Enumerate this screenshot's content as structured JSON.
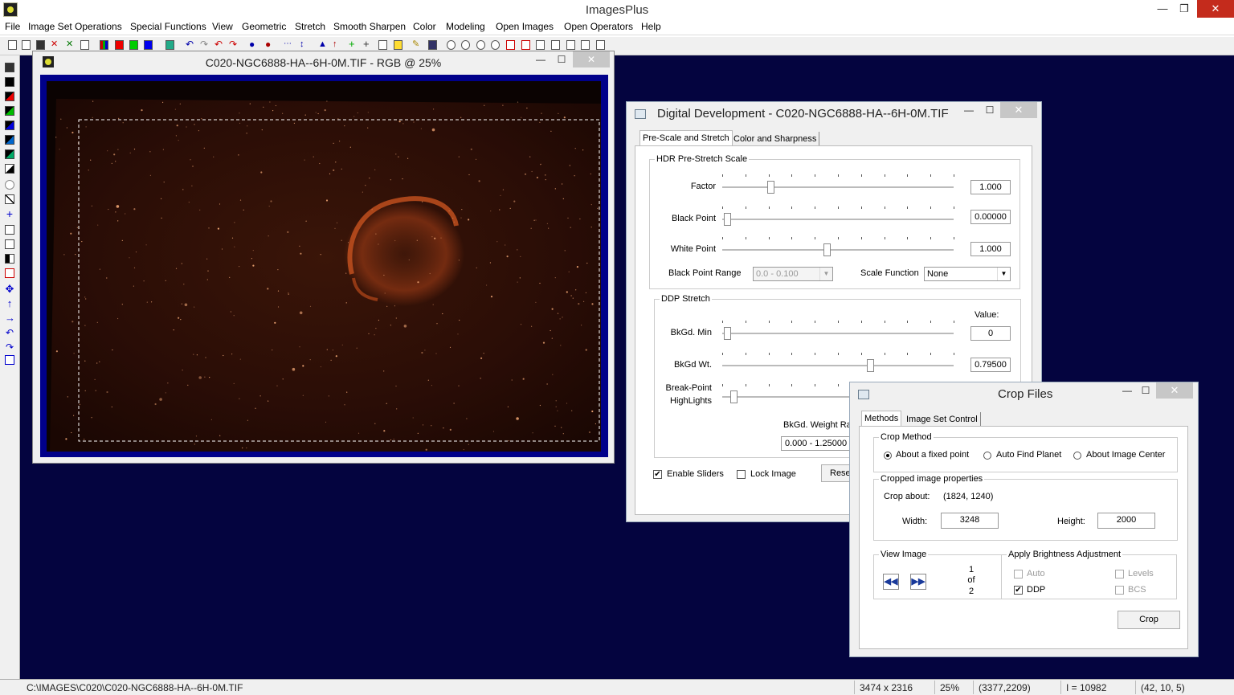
{
  "app": {
    "title": "ImagesPlus"
  },
  "menu": [
    "File",
    "Image Set Operations",
    "Special Functions",
    "View",
    "Geometric",
    "Stretch",
    "Smooth Sharpen",
    "Color",
    "Modeling",
    "Open Images",
    "Open Operators",
    "Help"
  ],
  "image_window": {
    "title": "C020-NGC6888-HA--6H-0M.TIF - RGB @ 25%"
  },
  "dev_dialog": {
    "title": "Digital Development - C020-NGC6888-HA--6H-0M.TIF",
    "tabs": [
      "Pre-Scale and Stretch",
      "Color and Sharpness"
    ],
    "hdr_group": "HDR Pre-Stretch Scale",
    "factor": {
      "label": "Factor",
      "value": "1.000",
      "slider_fraction": 0.21
    },
    "black_point": {
      "label": "Black Point",
      "value": "0.00000",
      "slider_fraction": 0.02
    },
    "white_point": {
      "label": "White Point",
      "value": "1.000",
      "slider_fraction": 0.45
    },
    "black_point_range": {
      "label": "Black Point Range",
      "value": "0.0 - 0.100"
    },
    "scale_function": {
      "label": "Scale Function",
      "value": "None"
    },
    "ddp_group": "DDP Stretch",
    "value_header": "Value:",
    "bkgd_min": {
      "label": "BkGd. Min",
      "value": "0",
      "slider_fraction": 0.02
    },
    "bkgd_wt": {
      "label": "BkGd Wt.",
      "value": "0.79500",
      "slider_fraction": 0.64
    },
    "break_point": {
      "label_line1": "Break-Point",
      "label_line2": "HighLights",
      "slider_fraction": 0.05
    },
    "bkgd_weight_range": {
      "label": "BkGd. Weight Ra",
      "value": "0.000 - 1.25000"
    },
    "enable_sliders": {
      "label": "Enable Sliders",
      "checked": true
    },
    "lock_image": {
      "label": "Lock Image",
      "checked": false
    },
    "reset_label": "Rese"
  },
  "crop_dialog": {
    "title": "Crop Files",
    "tabs": [
      "Methods",
      "Image Set Control"
    ],
    "crop_method_group": "Crop Method",
    "methods": [
      {
        "label": "About a fixed point",
        "selected": true
      },
      {
        "label": "Auto Find Planet",
        "selected": false
      },
      {
        "label": "About Image Center",
        "selected": false
      }
    ],
    "cropped_group": "Cropped image properties",
    "crop_about_label": "Crop about:",
    "crop_about_value": "(1824, 1240)",
    "width_label": "Width:",
    "width_value": "3248",
    "height_label": "Height:",
    "height_value": "2000",
    "view_group": "View Image",
    "view_counter": [
      "1",
      "of",
      "2"
    ],
    "brightness_group": "Apply Brightness Adjustment",
    "brightness": [
      {
        "label": "Auto",
        "checked": false,
        "enabled": false
      },
      {
        "label": "Levels",
        "checked": false,
        "enabled": false
      },
      {
        "label": "DDP",
        "checked": true,
        "enabled": true
      },
      {
        "label": "BCS",
        "checked": false,
        "enabled": false
      }
    ],
    "crop_button": "Crop"
  },
  "status": {
    "path": "C:\\IMAGES\\C020\\C020-NGC6888-HA--6H-0M.TIF",
    "dims": "3474 x 2316",
    "zoom": "25%",
    "coords": "(3377,2209)",
    "intensity": "I = 10982",
    "rgb": "(42, 10, 5)"
  },
  "colors": {
    "mdi_background": "#04043f",
    "image_frame": "#00008a",
    "close_red": "#c42b1c"
  }
}
